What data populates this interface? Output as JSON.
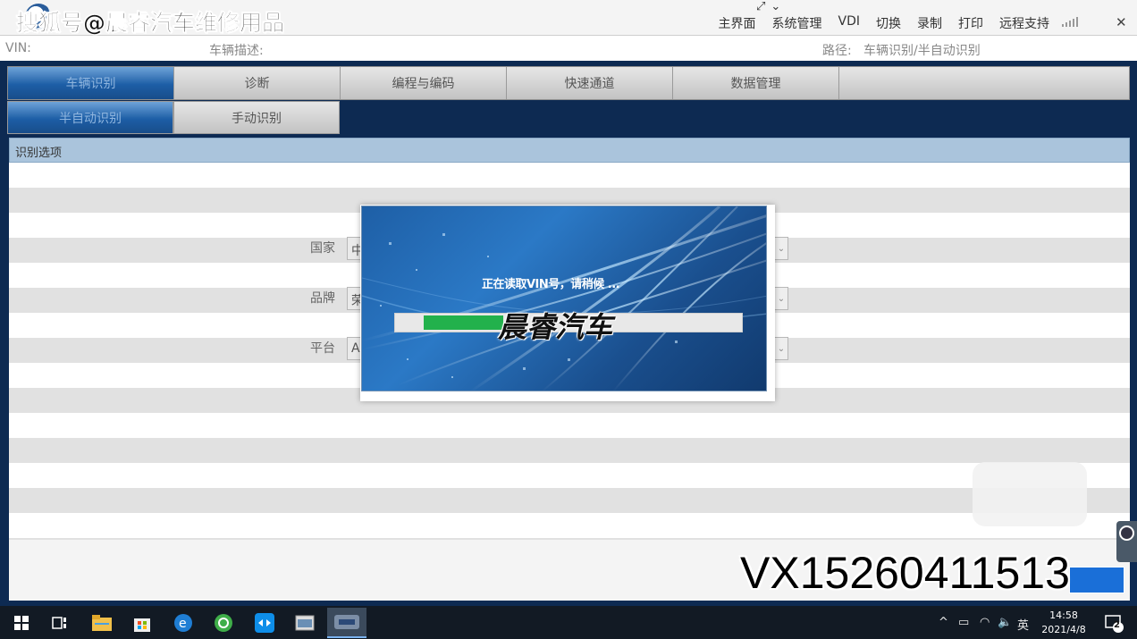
{
  "watermark_top": "搜狐号@晨睿汽车维修用品",
  "menu": [
    "主界面",
    "系统管理",
    "VDI",
    "切换",
    "录制",
    "打印",
    "远程支持"
  ],
  "info": {
    "vin_label": "VIN:",
    "desc_label": "车辆描述:",
    "path_label": "路径:",
    "path_value": "车辆识别/半自动识别"
  },
  "tabs": [
    "车辆识别",
    "诊断",
    "编程与编码",
    "快速通道",
    "数据管理"
  ],
  "subtabs": [
    "半自动识别",
    "手动识别"
  ],
  "panel_title": "识别选项",
  "fields": [
    {
      "label": "国家",
      "value": "中"
    },
    {
      "label": "品牌",
      "value": "荣"
    },
    {
      "label": "平台",
      "value": "A"
    }
  ],
  "modal": {
    "message": "正在读取VIN号，请稍候 ...",
    "progress": 0.23,
    "brand_watermark": "晨睿汽车"
  },
  "vx_watermark": "VX15260411513",
  "taskbar": {
    "time": "14:58",
    "date": "2021/4/8",
    "ime": "英",
    "notification_count": "2"
  },
  "colors": {
    "app_bg": "#0d2a52",
    "tab_active": "#1d5ea6",
    "progress": "#22b14c",
    "panel_head": "#aac4dc"
  }
}
